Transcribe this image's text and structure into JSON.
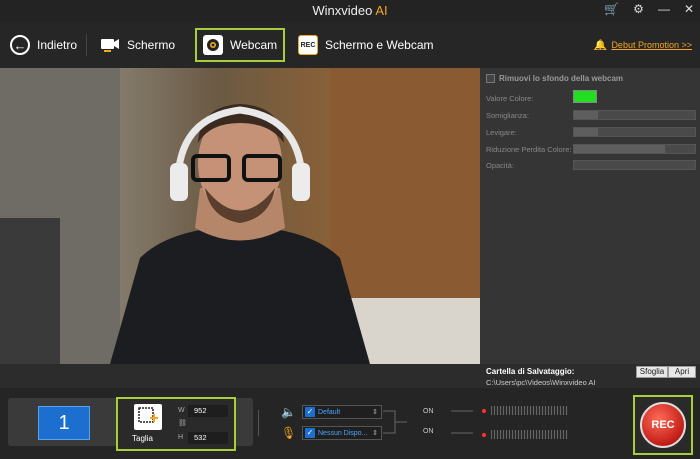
{
  "titlebar": {
    "app_name": "Winxvideo",
    "ai_tag": "AI"
  },
  "nav": {
    "back_label": "Indietro",
    "screen_label": "Schermo",
    "webcam_label": "Webcam",
    "rec_icon_text": "REC",
    "both_label": "Schermo e Webcam",
    "promo_label": "Debut Promotion >>"
  },
  "sidepanel": {
    "remove_bg_label": "Rimuovi lo sfondo della webcam",
    "color_label": "Valore Colore:",
    "color_value": "#22dd22",
    "similarity_label": "Somiglianza:",
    "similarity_value": 0.2,
    "smooth_label": "Levigare:",
    "smooth_value": 0.2,
    "spill_label": "Riduzione Perdita Colore:",
    "spill_value": 0.75,
    "opacity_label": "Opacità:",
    "opacity_value": 0.0,
    "save_folder_label": "Cartella di Salvataggio:",
    "save_path": "C:\\Users\\pc\\Videos\\Winxvideo AI",
    "browse_button": "Sfoglia",
    "open_button": "Apri"
  },
  "bottom": {
    "monitor_number": "1",
    "crop_label": "Taglia",
    "width_label": "W",
    "width_value": "952",
    "height_label": "H",
    "height_value": "532",
    "speaker_device": "Default",
    "mic_device": "Nessun Dispo...",
    "speaker_state": "ON",
    "mic_state": "ON",
    "rec_label": "REC"
  },
  "icons": {
    "back": "arrow-left-circle-icon",
    "screen": "monitor-camera-icon",
    "webcam": "webcam-icon",
    "both": "rec-icon",
    "promo": "bell-icon",
    "speaker": "speaker-icon",
    "mic": "microphone-icon"
  }
}
